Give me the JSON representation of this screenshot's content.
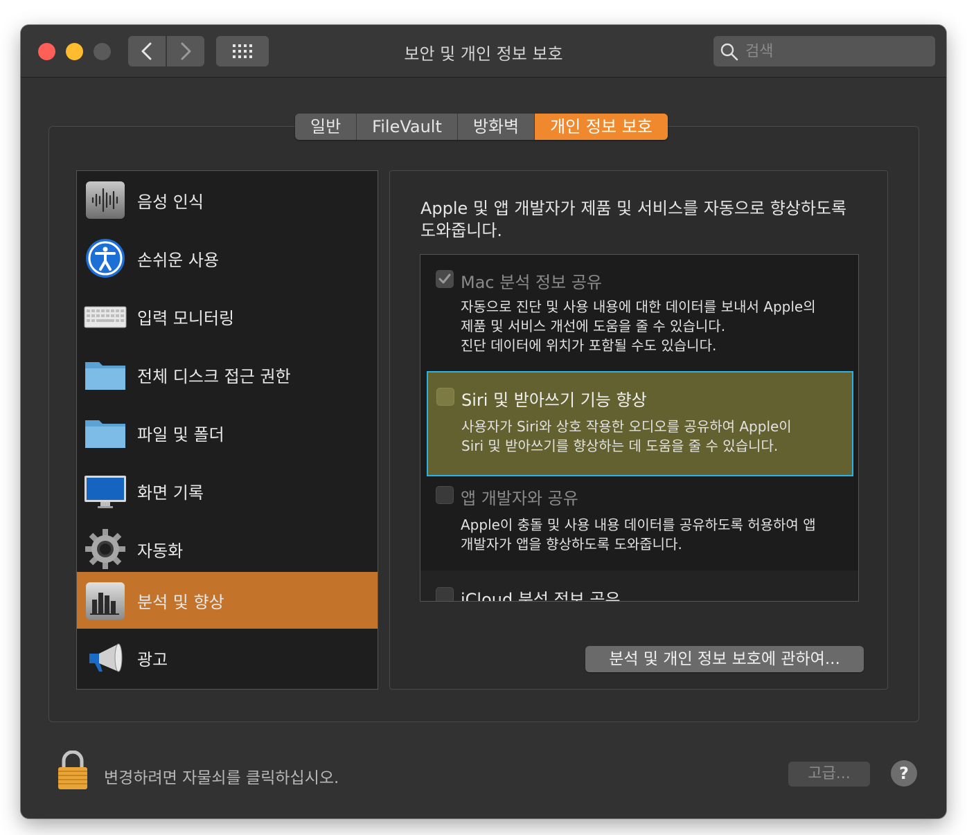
{
  "window": {
    "title": "보안 및 개인 정보 보호"
  },
  "search": {
    "placeholder": "검색"
  },
  "tabs": [
    {
      "label": "일반"
    },
    {
      "label": "FileVault"
    },
    {
      "label": "방화벽"
    },
    {
      "label": "개인 정보 보호",
      "active": true
    }
  ],
  "sidebar": {
    "items": [
      {
        "label": "음성 인식",
        "icon": "speech-recognition-icon"
      },
      {
        "label": "손쉬운 사용",
        "icon": "accessibility-icon"
      },
      {
        "label": "입력 모니터링",
        "icon": "keyboard-icon"
      },
      {
        "label": "전체 디스크 접근 권한",
        "icon": "folder-icon"
      },
      {
        "label": "파일 및 폴더",
        "icon": "folder-icon"
      },
      {
        "label": "화면 기록",
        "icon": "display-icon"
      },
      {
        "label": "자동화",
        "icon": "gear-icon"
      },
      {
        "label": "분석 및 향상",
        "icon": "bar-chart-icon",
        "selected": true
      },
      {
        "label": "광고",
        "icon": "megaphone-icon"
      }
    ]
  },
  "main": {
    "intro": "Apple 및 앱 개발자가 제품 및 서비스를 자동으로 향상하도록 도와줍니다.",
    "options": [
      {
        "title": "Mac 분석 정보 공유",
        "checked": true,
        "disabled": true,
        "description": "자동으로 진단 및 사용 내용에 대한 데이터를 보내서 Apple의\n제품 및 서비스 개선에 도움을 줄 수 있습니다.\n진단 데이터에 위치가 포함될 수도 있습니다."
      },
      {
        "title": "Siri 및 받아쓰기 기능 향상",
        "checked": false,
        "highlighted": true,
        "description": "사용자가 Siri와 상호 작용한 오디오를 공유하여 Apple이\nSiri 및 받아쓰기를 향상하는 데 도움을 줄 수 있습니다."
      },
      {
        "title": "앱 개발자와 공유",
        "checked": false,
        "disabled": true,
        "description": "Apple이 충돌 및 사용 내용 데이터를 공유하도록 허용하여 앱\n개발자가 앱을 향상하도록 도와줍니다."
      },
      {
        "title": "iCloud 분석 정보 공유",
        "checked": false
      }
    ],
    "about_button": "분석 및 개인 정보 보호에 관하여..."
  },
  "footer": {
    "lock_text": "변경하려면 자물쇠를 클릭하십시오.",
    "advanced_button": "고급...",
    "help_button": "?"
  },
  "colors": {
    "accent": "#f0892d",
    "selection": "#c4732a",
    "highlight_border": "#2ab4e6",
    "highlight_fill": "#646131"
  }
}
